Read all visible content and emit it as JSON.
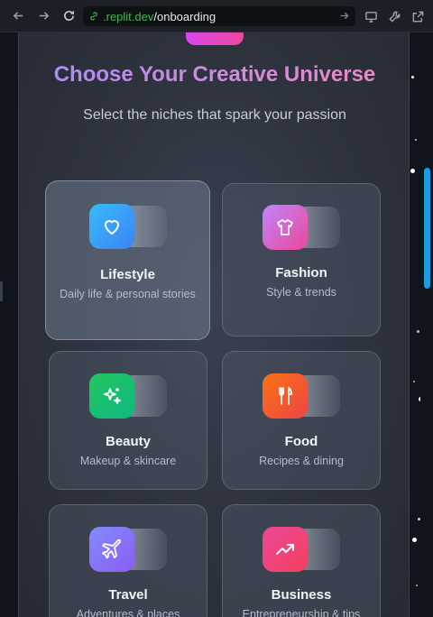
{
  "browser": {
    "url_domain": ".replit.dev",
    "url_path": "/onboarding"
  },
  "page": {
    "title": "Choose Your Creative Universe",
    "subtitle": "Select the niches that spark your passion"
  },
  "niches": [
    {
      "id": "lifestyle",
      "title": "Lifestyle",
      "description": "Daily life & personal stories",
      "icon": "heart-icon",
      "selected": true,
      "gradient": [
        "#38bdf8",
        "#3b82f6"
      ]
    },
    {
      "id": "fashion",
      "title": "Fashion",
      "description": "Style & trends",
      "icon": "shirt-icon",
      "selected": false,
      "gradient": [
        "#c084fc",
        "#ec4899"
      ]
    },
    {
      "id": "beauty",
      "title": "Beauty",
      "description": "Makeup & skincare",
      "icon": "sparkles-icon",
      "selected": false,
      "gradient": [
        "#22c55e",
        "#10b981"
      ]
    },
    {
      "id": "food",
      "title": "Food",
      "description": "Recipes & dining",
      "icon": "utensils-icon",
      "selected": false,
      "gradient": [
        "#f97316",
        "#ef4444"
      ]
    },
    {
      "id": "travel",
      "title": "Travel",
      "description": "Adventures & places",
      "icon": "plane-icon",
      "selected": false,
      "gradient": [
        "#818cf8",
        "#8b5cf6"
      ]
    },
    {
      "id": "business",
      "title": "Business",
      "description": "Entrepreneurship & tips",
      "icon": "trending-up-icon",
      "selected": false,
      "gradient": [
        "#ec4899",
        "#f43f5e"
      ]
    }
  ],
  "colors": {
    "accent_scroll": "#1e9be0",
    "title_gradient": [
      "#a78bfa",
      "#f087c0"
    ]
  }
}
